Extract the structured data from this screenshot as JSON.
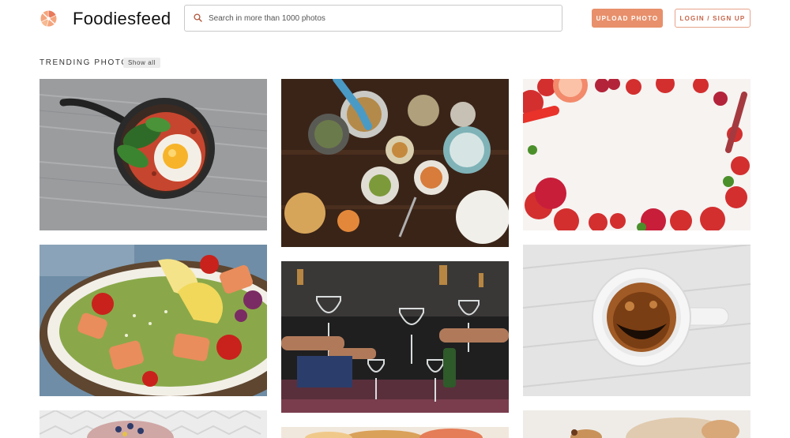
{
  "header": {
    "brand": "Foodiesfeed",
    "search_placeholder": "Search in more than 1000 photos",
    "search_value": "",
    "upload_label": "Upload photo",
    "login_label": "Login / Sign up"
  },
  "section": {
    "title": "Trending photos",
    "show_all_label": "Show all"
  },
  "photos": [
    {
      "subject": "egg-spinach-skillet"
    },
    {
      "subject": "dinner-table-overhead"
    },
    {
      "subject": "fruit-vegetable-frame"
    },
    {
      "subject": "salmon-salad-lemon"
    },
    {
      "subject": "wine-glasses-toast"
    },
    {
      "subject": "espresso-cup-smile"
    },
    {
      "subject": "bowl-on-tiles"
    },
    {
      "subject": "fruit-slices"
    },
    {
      "subject": "pastry-plate"
    }
  ],
  "colors": {
    "upload_button": "#e8906b",
    "login_border": "#e6a38a",
    "login_text": "#c7654a",
    "logo": "#f0956c"
  }
}
